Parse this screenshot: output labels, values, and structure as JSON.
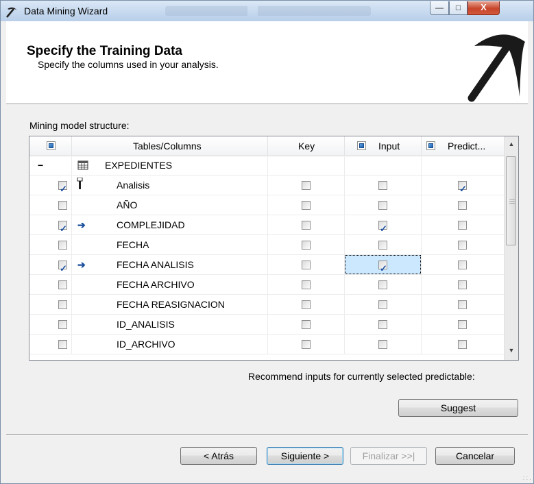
{
  "window": {
    "title": "Data Mining Wizard",
    "title_icon": "pickaxe-icon",
    "minimize": "—",
    "maximize": "□",
    "close": "X"
  },
  "header": {
    "title": "Specify the Training Data",
    "subtitle": "Specify the columns used in your analysis.",
    "logo_icon": "pickaxe-icon"
  },
  "structure_label": "Mining model structure:",
  "grid": {
    "headers": {
      "tables_columns": "Tables/Columns",
      "key": "Key",
      "input": "Input",
      "predict": "Predict..."
    },
    "table": {
      "expander": "−",
      "icon": "table-icon",
      "name": "EXPEDIENTES"
    },
    "rows": [
      {
        "name": "Analisis",
        "selected": true,
        "icon": "key-icon",
        "key": false,
        "input": false,
        "predict": true
      },
      {
        "name": "AÑO",
        "selected": false,
        "icon": "",
        "key": false,
        "input": false,
        "predict": false
      },
      {
        "name": "COMPLEJIDAD",
        "selected": true,
        "icon": "input-arrow-icon",
        "key": false,
        "input": true,
        "predict": false
      },
      {
        "name": "FECHA",
        "selected": false,
        "icon": "",
        "key": false,
        "input": false,
        "predict": false
      },
      {
        "name": "FECHA ANALISIS",
        "selected": true,
        "icon": "input-arrow-icon",
        "key": false,
        "input": true,
        "predict": false,
        "focused": "input"
      },
      {
        "name": "FECHA ARCHIVO",
        "selected": false,
        "icon": "",
        "key": false,
        "input": false,
        "predict": false
      },
      {
        "name": "FECHA REASIGNACION",
        "selected": false,
        "icon": "",
        "key": false,
        "input": false,
        "predict": false
      },
      {
        "name": "ID_ANALISIS",
        "selected": false,
        "icon": "",
        "key": false,
        "input": false,
        "predict": false
      },
      {
        "name": "ID_ARCHIVO",
        "selected": false,
        "icon": "",
        "key": false,
        "input": false,
        "predict": false
      }
    ]
  },
  "recommend_text": "Recommend inputs for currently selected predictable:",
  "buttons": {
    "suggest": "Suggest",
    "back": "< Atrás",
    "next": "Siguiente >",
    "finish": "Finalizar >>|",
    "cancel": "Cancelar"
  },
  "colors": {
    "focus_cell": "#cce8ff",
    "check": "#1d4fa0",
    "close_button": "#c7442a"
  }
}
